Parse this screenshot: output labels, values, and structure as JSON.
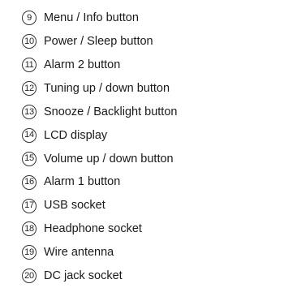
{
  "legend": {
    "items": [
      {
        "number": "9",
        "label": "Menu / Info button"
      },
      {
        "number": "10",
        "label": "Power / Sleep button"
      },
      {
        "number": "11",
        "label": "Alarm 2 button"
      },
      {
        "number": "12",
        "label": "Tuning up / down button"
      },
      {
        "number": "13",
        "label": "Snooze / Backlight button"
      },
      {
        "number": "14",
        "label": "LCD display"
      },
      {
        "number": "15",
        "label": "Volume up / down button"
      },
      {
        "number": "16",
        "label": "Alarm 1 button"
      },
      {
        "number": "17",
        "label": "USB socket"
      },
      {
        "number": "18",
        "label": "Headphone socket"
      },
      {
        "number": "19",
        "label": "Wire antenna"
      },
      {
        "number": "20",
        "label": "DC jack socket"
      }
    ]
  }
}
